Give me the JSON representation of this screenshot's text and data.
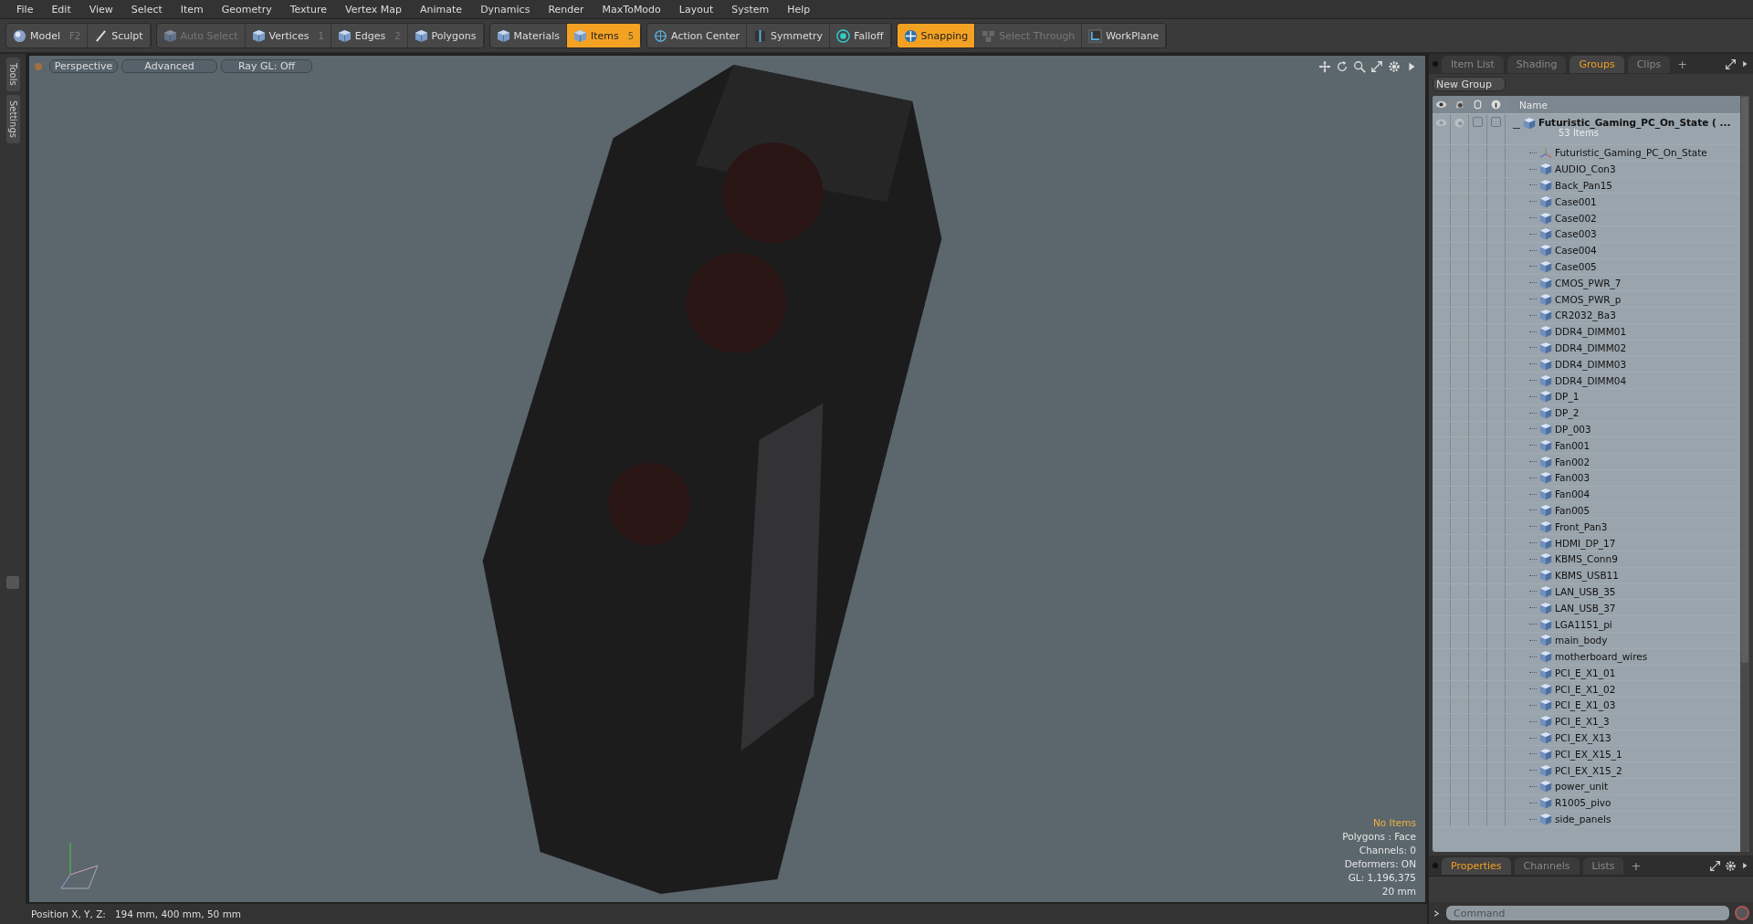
{
  "menu": [
    "File",
    "Edit",
    "View",
    "Select",
    "Item",
    "Geometry",
    "Texture",
    "Vertex Map",
    "Animate",
    "Dynamics",
    "Render",
    "MaxToModo",
    "Layout",
    "System",
    "Help"
  ],
  "toolbar": [
    {
      "items": [
        {
          "label": "Model",
          "hotkey": "F2",
          "selected": false,
          "disabled": false
        },
        {
          "label": "Sculpt",
          "selected": false,
          "disabled": false
        }
      ]
    },
    {
      "items": [
        {
          "label": "Auto Select",
          "selected": false,
          "disabled": true
        },
        {
          "label": "Vertices",
          "hotkey": "1",
          "selected": false,
          "disabled": false
        },
        {
          "label": "Edges",
          "hotkey": "2",
          "selected": false,
          "disabled": false
        },
        {
          "label": "Polygons",
          "selected": false,
          "disabled": false
        }
      ]
    },
    {
      "items": [
        {
          "label": "Materials",
          "selected": false,
          "disabled": false
        },
        {
          "label": "Items",
          "hotkey": "5",
          "selected": true,
          "disabled": false
        }
      ]
    },
    {
      "items": [
        {
          "label": "Action Center",
          "selected": false,
          "disabled": false
        },
        {
          "label": "Symmetry",
          "selected": false,
          "disabled": false
        },
        {
          "label": "Falloff",
          "selected": false,
          "disabled": false
        }
      ]
    },
    {
      "items": [
        {
          "label": "Snapping",
          "selected": true,
          "disabled": false
        },
        {
          "label": "Select Through",
          "selected": false,
          "disabled": true
        },
        {
          "label": "WorkPlane",
          "selected": false,
          "disabled": false
        }
      ]
    }
  ],
  "side_tabs": [
    "Tools",
    "Settings"
  ],
  "viewport": {
    "buttons": [
      "Perspective",
      "Advanced",
      "Ray GL: Off"
    ],
    "info": [
      {
        "text": "No Items",
        "kind": "warning"
      },
      {
        "text": "Polygons : Face",
        "kind": "plain"
      },
      {
        "text": "Channels: 0",
        "kind": "plain"
      },
      {
        "text": "Deformers: ON",
        "kind": "plain"
      },
      {
        "text": "GL: 1,196,375",
        "kind": "plain"
      },
      {
        "text": "20 mm",
        "kind": "plain"
      }
    ]
  },
  "status_bar": {
    "label": "Position X, Y, Z:",
    "value": "194 mm, 400 mm, 50 mm"
  },
  "panel": {
    "tabs": [
      {
        "label": "Item List",
        "selected": false
      },
      {
        "label": "Shading",
        "selected": false
      },
      {
        "label": "Groups",
        "selected": true
      },
      {
        "label": "Clips",
        "selected": false
      }
    ],
    "add_tab": "+",
    "new_group": "New Group",
    "column_header": "Name",
    "tree": [
      {
        "name": "Futuristic_Gaming_PC_On_State ( ...",
        "count": "53 Items",
        "expanded": true,
        "locked": false,
        "flagged": false,
        "children": [
          {
            "name": "Futuristic_Gaming_PC_On_State",
            "kind": "locator"
          },
          {
            "name": "AUDIO_Con3",
            "kind": "mesh"
          },
          {
            "name": "Back_Pan15",
            "kind": "mesh"
          },
          {
            "name": "Case001",
            "kind": "mesh"
          },
          {
            "name": "Case002",
            "kind": "mesh"
          },
          {
            "name": "Case003",
            "kind": "mesh"
          },
          {
            "name": "Case004",
            "kind": "mesh"
          },
          {
            "name": "Case005",
            "kind": "mesh"
          },
          {
            "name": "CMOS_PWR_7",
            "kind": "mesh"
          },
          {
            "name": "CMOS_PWR_p",
            "kind": "mesh"
          },
          {
            "name": "CR2032_Ba3",
            "kind": "mesh"
          },
          {
            "name": "DDR4_DIMM01",
            "kind": "mesh"
          },
          {
            "name": "DDR4_DIMM02",
            "kind": "mesh"
          },
          {
            "name": "DDR4_DIMM03",
            "kind": "mesh"
          },
          {
            "name": "DDR4_DIMM04",
            "kind": "mesh"
          },
          {
            "name": "DP_1",
            "kind": "mesh"
          },
          {
            "name": "DP_2",
            "kind": "mesh"
          },
          {
            "name": "DP_003",
            "kind": "mesh"
          },
          {
            "name": "Fan001",
            "kind": "mesh"
          },
          {
            "name": "Fan002",
            "kind": "mesh"
          },
          {
            "name": "Fan003",
            "kind": "mesh"
          },
          {
            "name": "Fan004",
            "kind": "mesh"
          },
          {
            "name": "Fan005",
            "kind": "mesh"
          },
          {
            "name": "Front_Pan3",
            "kind": "mesh"
          },
          {
            "name": "HDMI_DP_17",
            "kind": "mesh"
          },
          {
            "name": "KBMS_Conn9",
            "kind": "mesh"
          },
          {
            "name": "KBMS_USB11",
            "kind": "mesh"
          },
          {
            "name": "LAN_USB_35",
            "kind": "mesh"
          },
          {
            "name": "LAN_USB_37",
            "kind": "mesh"
          },
          {
            "name": "LGA1151_pi",
            "kind": "mesh"
          },
          {
            "name": "main_body",
            "kind": "mesh"
          },
          {
            "name": "motherboard_wires",
            "kind": "mesh"
          },
          {
            "name": "PCI_E_X1_01",
            "kind": "mesh"
          },
          {
            "name": "PCI_E_X1_02",
            "kind": "mesh"
          },
          {
            "name": "PCI_E_X1_03",
            "kind": "mesh"
          },
          {
            "name": "PCI_E_X1_3",
            "kind": "mesh"
          },
          {
            "name": "PCI_EX_X13",
            "kind": "mesh"
          },
          {
            "name": "PCI_EX_X15_1",
            "kind": "mesh"
          },
          {
            "name": "PCI_EX_X15_2",
            "kind": "mesh"
          },
          {
            "name": "power_unit",
            "kind": "mesh"
          },
          {
            "name": "R1005_pivo",
            "kind": "mesh"
          },
          {
            "name": "side_panels",
            "kind": "mesh"
          }
        ]
      }
    ]
  },
  "bottom_panel": {
    "tabs": [
      {
        "label": "Properties",
        "selected": true
      },
      {
        "label": "Channels",
        "selected": false
      },
      {
        "label": "Lists",
        "selected": false
      }
    ],
    "add_tab": "+",
    "command_placeholder": "Command"
  }
}
